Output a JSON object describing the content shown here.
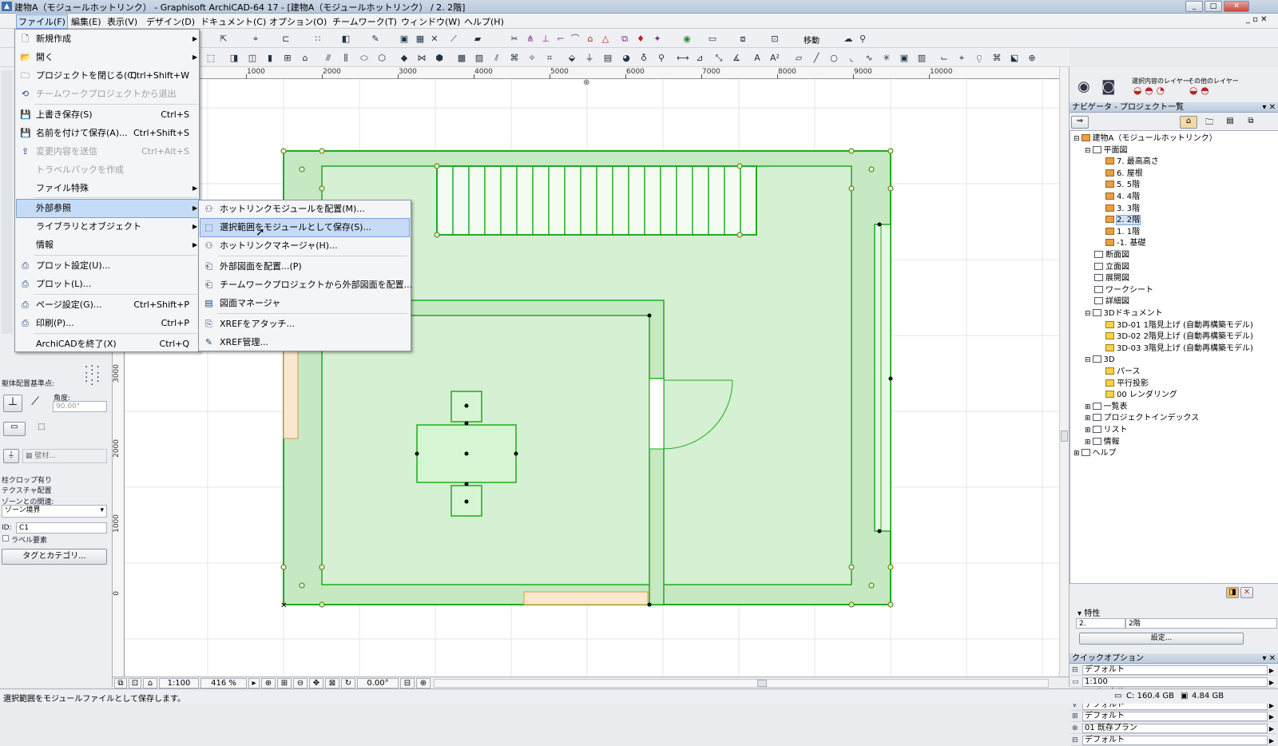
{
  "window": {
    "title": "建物A（モジュールホットリンク） - Graphisoft ArchiCAD-64 17 - [建物A（モジュールホットリンク） / 2. 2階]"
  },
  "menubar": [
    "ファイル(F)",
    "編集(E)",
    "表示(V)",
    "デザイン(D)",
    "ドキュメント(C)",
    "オプション(O)",
    "チームワーク(T)",
    "ウィンドウ(W)",
    "ヘルプ(H)"
  ],
  "toolbar": {
    "move_label": "移動"
  },
  "file_menu": [
    {
      "label": "新規作成",
      "shortcut": "",
      "submenu": true
    },
    {
      "label": "開く",
      "shortcut": "",
      "submenu": true
    },
    {
      "label": "プロジェクトを閉じる(C)",
      "shortcut": "Ctrl+Shift+W"
    },
    {
      "label": "チームワークプロジェクトから退出",
      "shortcut": "",
      "disabled": true
    },
    {
      "label": "上書き保存(S)",
      "shortcut": "Ctrl+S"
    },
    {
      "label": "名前を付けて保存(A)...",
      "shortcut": "Ctrl+Shift+S"
    },
    {
      "label": "変更内容を送信",
      "shortcut": "Ctrl+Alt+S",
      "disabled": true
    },
    {
      "label": "トラベルパックを作成",
      "shortcut": "",
      "disabled": true
    },
    {
      "label": "ファイル特殊",
      "shortcut": "",
      "submenu": true
    },
    {
      "label": "外部参照",
      "shortcut": "",
      "submenu": true,
      "highlighted": true
    },
    {
      "label": "ライブラリとオブジェクト",
      "shortcut": "",
      "submenu": true
    },
    {
      "label": "情報",
      "shortcut": "",
      "submenu": true
    },
    {
      "label": "プロット設定(U)...",
      "shortcut": ""
    },
    {
      "label": "プロット(L)...",
      "shortcut": ""
    },
    {
      "label": "ページ設定(G)...",
      "shortcut": "Ctrl+Shift+P"
    },
    {
      "label": "印刷(P)...",
      "shortcut": "Ctrl+P"
    },
    {
      "label": "ArchiCADを終了(X)",
      "shortcut": "Ctrl+Q"
    }
  ],
  "xref_submenu": [
    {
      "label": "ホットリンクモジュールを配置(M)..."
    },
    {
      "label": "選択範囲をモジュールとして保存(S)...",
      "highlighted": true
    },
    {
      "label": "ホットリンクマネージャ(H)..."
    },
    {
      "label": "外部図面を配置...(P)"
    },
    {
      "label": "チームワークプロジェクトから外部図面を配置..."
    },
    {
      "label": "図面マネージャ"
    },
    {
      "label": "XREFをアタッチ..."
    },
    {
      "label": "XREF管理..."
    }
  ],
  "ruler_top": [
    "1000",
    "0",
    "1000",
    "2000",
    "3000",
    "4000",
    "5000",
    "6000",
    "7000",
    "8000",
    "9000",
    "10000"
  ],
  "ruler_left": [
    "3000",
    "2000",
    "1000",
    "0"
  ],
  "toolbox": {
    "anchor_label": "躯体配置基準点:",
    "angle_label": "角度:",
    "angle_value": "90.00°",
    "material_label": "壁材...",
    "crop_label": "柱クロップ有り",
    "texture_label": "テクスチャ配置",
    "zone_label": "ゾーンとの関連:",
    "zone_value": "ゾーン境界",
    "id_label": "ID:",
    "id_value": "C1",
    "label_checkbox": "ラベル要素",
    "tags_button": "タグとカテゴリ..."
  },
  "right_panel": {
    "layer_label_1": "選択内容のレイヤー",
    "layer_label_2": "その他のレイヤー",
    "navigator_title": "ナビゲータ - プロジェクト一覧",
    "tree": [
      {
        "label": "建物A（モジュールホットリンク）",
        "level": 0,
        "icon": "fold",
        "exp": "⊟"
      },
      {
        "label": "平面図",
        "level": 1,
        "icon": "doc",
        "exp": "⊟"
      },
      {
        "label": "7. 最高高さ",
        "level": 2,
        "icon": "fold"
      },
      {
        "label": "6. 屋根",
        "level": 2,
        "icon": "fold"
      },
      {
        "label": "5. 5階",
        "level": 2,
        "icon": "fold"
      },
      {
        "label": "4. 4階",
        "level": 2,
        "icon": "fold"
      },
      {
        "label": "3. 3階",
        "level": 2,
        "icon": "fold"
      },
      {
        "label": "2. 2階",
        "level": 2,
        "icon": "fold",
        "selected": true
      },
      {
        "label": "1. 1階",
        "level": 2,
        "icon": "fold"
      },
      {
        "label": "-1. 基礎",
        "level": 2,
        "icon": "fold"
      },
      {
        "label": "断面図",
        "level": 1,
        "icon": "doc"
      },
      {
        "label": "立面図",
        "level": 1,
        "icon": "doc"
      },
      {
        "label": "展開図",
        "level": 1,
        "icon": "doc"
      },
      {
        "label": "ワークシート",
        "level": 1,
        "icon": "doc"
      },
      {
        "label": "詳細図",
        "level": 1,
        "icon": "doc"
      },
      {
        "label": "3Dドキュメント",
        "level": 1,
        "icon": "doc",
        "exp": "⊟"
      },
      {
        "label": "3D-01 1階見上げ (自動再構築モデル)",
        "level": 2,
        "icon": "cube"
      },
      {
        "label": "3D-02 2階見上げ (自動再構築モデル)",
        "level": 2,
        "icon": "cube"
      },
      {
        "label": "3D-03 3階見上げ (自動再構築モデル)",
        "level": 2,
        "icon": "cube"
      },
      {
        "label": "3D",
        "level": 1,
        "icon": "doc",
        "exp": "⊟"
      },
      {
        "label": "パース",
        "level": 2,
        "icon": "cube"
      },
      {
        "label": "平行投影",
        "level": 2,
        "icon": "cube"
      },
      {
        "label": "00 レンダリング",
        "level": 2,
        "icon": "cube"
      },
      {
        "label": "一覧表",
        "level": 1,
        "icon": "doc",
        "exp": "⊞"
      },
      {
        "label": "プロジェクトインデックス",
        "level": 1,
        "icon": "doc",
        "exp": "⊞"
      },
      {
        "label": "リスト",
        "level": 1,
        "icon": "doc",
        "exp": "⊞"
      },
      {
        "label": "情報",
        "level": 1,
        "icon": "doc",
        "exp": "⊞"
      },
      {
        "label": "ヘルプ",
        "level": 0,
        "icon": "doc",
        "exp": "⊞"
      }
    ],
    "properties_title": "特性",
    "prop_id": "2.",
    "prop_name": "2階",
    "settings_button": "設定...",
    "quick_options_title": "クイックオプション",
    "quick_options": [
      "デフォルト",
      "1:100",
      "モデル全体",
      "デフォルト",
      "デフォルト",
      "01 既存プラン",
      "デフォルト"
    ]
  },
  "bottom": {
    "scale": "1:100",
    "zoom": "416 %",
    "angle": "0.00°"
  },
  "status": {
    "message": "選択範囲をモジュールファイルとして保存します。",
    "disk_c": "C: 160.4 GB",
    "ram": "4.84 GB"
  }
}
